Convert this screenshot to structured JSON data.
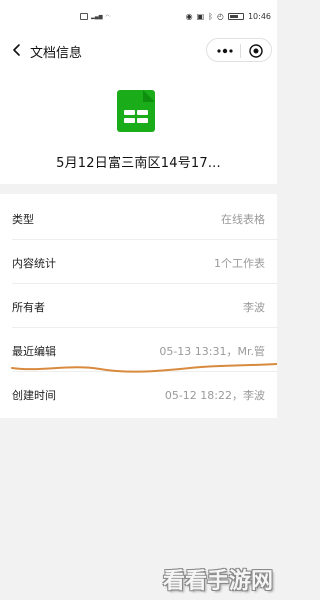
{
  "status_bar": {
    "time": "10:46",
    "battery": "80",
    "left_glyphs": "☷"
  },
  "nav": {
    "title": "文档信息"
  },
  "document": {
    "title": "5月12日富三南区14号17...",
    "icon": "spreadsheet-icon",
    "icon_color": "#1aad19"
  },
  "info_rows": [
    {
      "label": "类型",
      "value": "在线表格"
    },
    {
      "label": "内容统计",
      "value": "1个工作表"
    },
    {
      "label": "所有者",
      "value": "李波"
    },
    {
      "label": "最近编辑",
      "value": "05-13 13:31，Mr.管"
    },
    {
      "label": "创建时间",
      "value": "05-12 18:22，李波"
    }
  ],
  "watermark": "看看手游网",
  "annotation_color": "#d88a3e"
}
